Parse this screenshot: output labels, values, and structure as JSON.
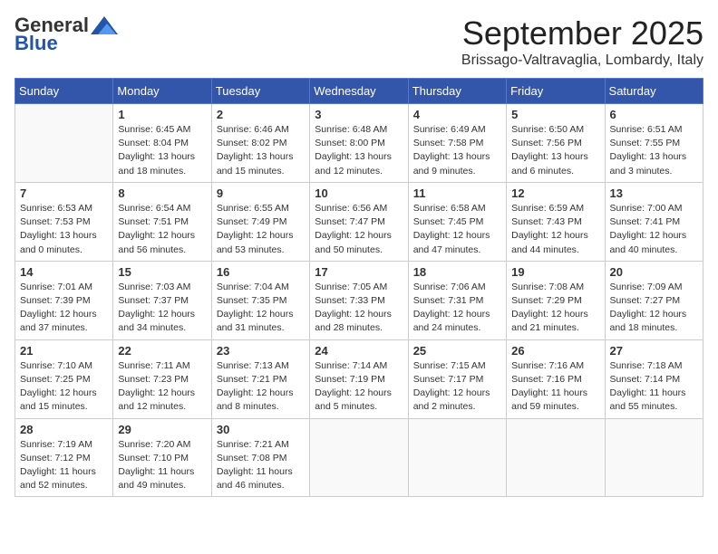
{
  "header": {
    "logo_general": "General",
    "logo_blue": "Blue",
    "month": "September 2025",
    "location": "Brissago-Valtravaglia, Lombardy, Italy"
  },
  "days_of_week": [
    "Sunday",
    "Monday",
    "Tuesday",
    "Wednesday",
    "Thursday",
    "Friday",
    "Saturday"
  ],
  "weeks": [
    [
      {
        "day": "",
        "info": ""
      },
      {
        "day": "1",
        "info": "Sunrise: 6:45 AM\nSunset: 8:04 PM\nDaylight: 13 hours\nand 18 minutes."
      },
      {
        "day": "2",
        "info": "Sunrise: 6:46 AM\nSunset: 8:02 PM\nDaylight: 13 hours\nand 15 minutes."
      },
      {
        "day": "3",
        "info": "Sunrise: 6:48 AM\nSunset: 8:00 PM\nDaylight: 13 hours\nand 12 minutes."
      },
      {
        "day": "4",
        "info": "Sunrise: 6:49 AM\nSunset: 7:58 PM\nDaylight: 13 hours\nand 9 minutes."
      },
      {
        "day": "5",
        "info": "Sunrise: 6:50 AM\nSunset: 7:56 PM\nDaylight: 13 hours\nand 6 minutes."
      },
      {
        "day": "6",
        "info": "Sunrise: 6:51 AM\nSunset: 7:55 PM\nDaylight: 13 hours\nand 3 minutes."
      }
    ],
    [
      {
        "day": "7",
        "info": "Sunrise: 6:53 AM\nSunset: 7:53 PM\nDaylight: 13 hours\nand 0 minutes."
      },
      {
        "day": "8",
        "info": "Sunrise: 6:54 AM\nSunset: 7:51 PM\nDaylight: 12 hours\nand 56 minutes."
      },
      {
        "day": "9",
        "info": "Sunrise: 6:55 AM\nSunset: 7:49 PM\nDaylight: 12 hours\nand 53 minutes."
      },
      {
        "day": "10",
        "info": "Sunrise: 6:56 AM\nSunset: 7:47 PM\nDaylight: 12 hours\nand 50 minutes."
      },
      {
        "day": "11",
        "info": "Sunrise: 6:58 AM\nSunset: 7:45 PM\nDaylight: 12 hours\nand 47 minutes."
      },
      {
        "day": "12",
        "info": "Sunrise: 6:59 AM\nSunset: 7:43 PM\nDaylight: 12 hours\nand 44 minutes."
      },
      {
        "day": "13",
        "info": "Sunrise: 7:00 AM\nSunset: 7:41 PM\nDaylight: 12 hours\nand 40 minutes."
      }
    ],
    [
      {
        "day": "14",
        "info": "Sunrise: 7:01 AM\nSunset: 7:39 PM\nDaylight: 12 hours\nand 37 minutes."
      },
      {
        "day": "15",
        "info": "Sunrise: 7:03 AM\nSunset: 7:37 PM\nDaylight: 12 hours\nand 34 minutes."
      },
      {
        "day": "16",
        "info": "Sunrise: 7:04 AM\nSunset: 7:35 PM\nDaylight: 12 hours\nand 31 minutes."
      },
      {
        "day": "17",
        "info": "Sunrise: 7:05 AM\nSunset: 7:33 PM\nDaylight: 12 hours\nand 28 minutes."
      },
      {
        "day": "18",
        "info": "Sunrise: 7:06 AM\nSunset: 7:31 PM\nDaylight: 12 hours\nand 24 minutes."
      },
      {
        "day": "19",
        "info": "Sunrise: 7:08 AM\nSunset: 7:29 PM\nDaylight: 12 hours\nand 21 minutes."
      },
      {
        "day": "20",
        "info": "Sunrise: 7:09 AM\nSunset: 7:27 PM\nDaylight: 12 hours\nand 18 minutes."
      }
    ],
    [
      {
        "day": "21",
        "info": "Sunrise: 7:10 AM\nSunset: 7:25 PM\nDaylight: 12 hours\nand 15 minutes."
      },
      {
        "day": "22",
        "info": "Sunrise: 7:11 AM\nSunset: 7:23 PM\nDaylight: 12 hours\nand 12 minutes."
      },
      {
        "day": "23",
        "info": "Sunrise: 7:13 AM\nSunset: 7:21 PM\nDaylight: 12 hours\nand 8 minutes."
      },
      {
        "day": "24",
        "info": "Sunrise: 7:14 AM\nSunset: 7:19 PM\nDaylight: 12 hours\nand 5 minutes."
      },
      {
        "day": "25",
        "info": "Sunrise: 7:15 AM\nSunset: 7:17 PM\nDaylight: 12 hours\nand 2 minutes."
      },
      {
        "day": "26",
        "info": "Sunrise: 7:16 AM\nSunset: 7:16 PM\nDaylight: 11 hours\nand 59 minutes."
      },
      {
        "day": "27",
        "info": "Sunrise: 7:18 AM\nSunset: 7:14 PM\nDaylight: 11 hours\nand 55 minutes."
      }
    ],
    [
      {
        "day": "28",
        "info": "Sunrise: 7:19 AM\nSunset: 7:12 PM\nDaylight: 11 hours\nand 52 minutes."
      },
      {
        "day": "29",
        "info": "Sunrise: 7:20 AM\nSunset: 7:10 PM\nDaylight: 11 hours\nand 49 minutes."
      },
      {
        "day": "30",
        "info": "Sunrise: 7:21 AM\nSunset: 7:08 PM\nDaylight: 11 hours\nand 46 minutes."
      },
      {
        "day": "",
        "info": ""
      },
      {
        "day": "",
        "info": ""
      },
      {
        "day": "",
        "info": ""
      },
      {
        "day": "",
        "info": ""
      }
    ]
  ]
}
